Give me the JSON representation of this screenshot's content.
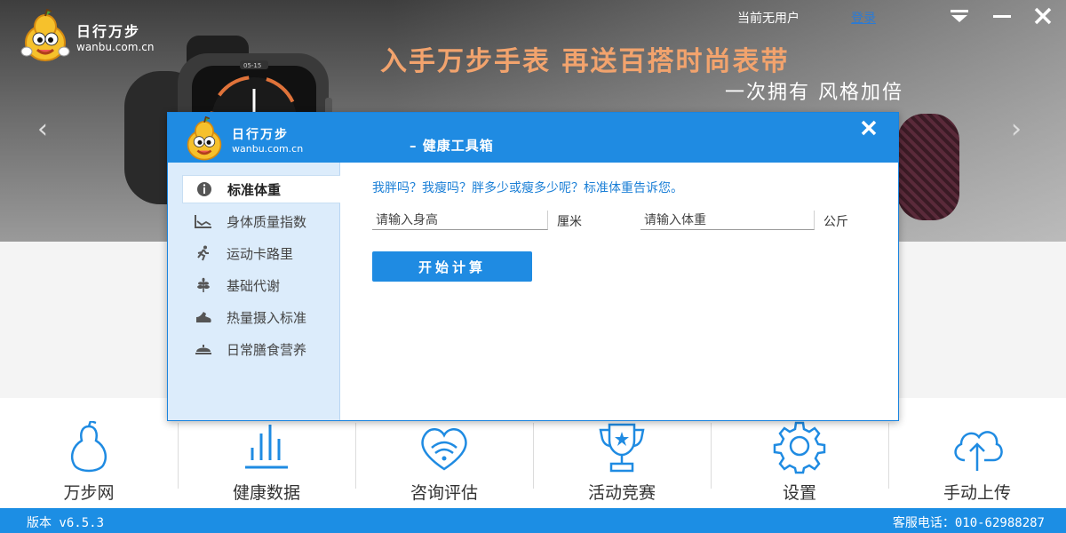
{
  "app": {
    "logo_cn": "日行万步",
    "logo_url": "wanbu.com.cn"
  },
  "topbar": {
    "user_status": "当前无用户",
    "login": "登录"
  },
  "banner": {
    "headline": "入手万步手表  再送百搭时尚表带",
    "subline": "一次拥有 风格加倍",
    "prev": "‹",
    "next": "›",
    "watch_face": "05-15"
  },
  "dialog": {
    "title": "– 健康工具箱",
    "sidebar": [
      {
        "label": "标准体重",
        "icon": "info-icon",
        "active": true
      },
      {
        "label": "身体质量指数",
        "icon": "line-chart-icon",
        "active": false
      },
      {
        "label": "运动卡路里",
        "icon": "runner-icon",
        "active": false
      },
      {
        "label": "基础代谢",
        "icon": "wheat-icon",
        "active": false
      },
      {
        "label": "热量摄入标准",
        "icon": "shoe-icon",
        "active": false
      },
      {
        "label": "日常膳食营养",
        "icon": "food-cover-icon",
        "active": false
      }
    ],
    "question": "我胖吗？我瘦吗？胖多少或瘦多少呢？标准体重告诉您。",
    "height_placeholder": "请输入身高",
    "height_unit": "厘米",
    "weight_placeholder": "请输入体重",
    "weight_unit": "公斤",
    "calc_button": "开始计算"
  },
  "bottom_nav": [
    {
      "label": "万步网",
      "icon": "pear-mascot-icon"
    },
    {
      "label": "健康数据",
      "icon": "bar-chart-icon"
    },
    {
      "label": "咨询评估",
      "icon": "heart-chat-icon"
    },
    {
      "label": "活动竞赛",
      "icon": "trophy-icon"
    },
    {
      "label": "设置",
      "icon": "gear-icon"
    },
    {
      "label": "手动上传",
      "icon": "cloud-upload-icon"
    }
  ],
  "status": {
    "version": "版本 v6.5.3",
    "hotline": "客服电话：010-62988287"
  },
  "colors": {
    "accent": "#1f8be2",
    "slogan": "#f2a36d",
    "link": "#2c7bd4"
  }
}
